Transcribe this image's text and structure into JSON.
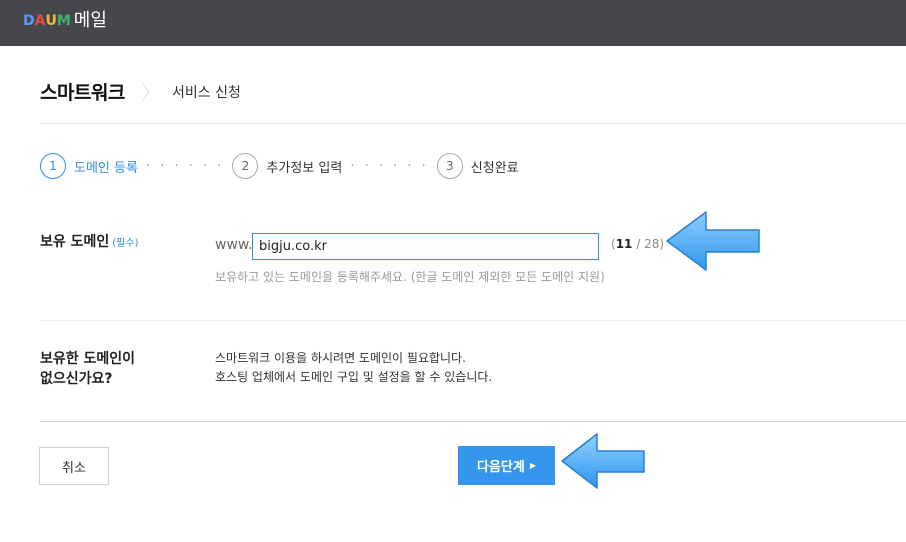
{
  "topbar": {
    "logo_letters": [
      "D",
      "A",
      "U",
      "M"
    ],
    "logo_colors": [
      "#5b9cf5",
      "#ec4a3b",
      "#f5b83d",
      "#3bb56a"
    ],
    "app_title": "메일",
    "background": "#45474d"
  },
  "header": {
    "brand": "스마트워크",
    "subtitle": "서비스 신청"
  },
  "steps": [
    {
      "number": "1",
      "label": "도메인 등록",
      "active": true
    },
    {
      "number": "2",
      "label": "추가정보 입력",
      "active": false
    },
    {
      "number": "3",
      "label": "신청완료",
      "active": false
    }
  ],
  "step_separator": "· · · · · ·",
  "domain_row": {
    "label": "보유 도메인",
    "required": "(필수)",
    "prefix": "www.",
    "value": "bigju.co.kr",
    "counter_open": "(",
    "counter_current": "11",
    "counter_rest": " / 28)",
    "help": "보유하고 있는 도메인을 등록해주세요. (한글 도메인 제외한 모든 도메인 지원)"
  },
  "no_domain_row": {
    "label_line1": "보유한 도메인이",
    "label_line2": "없으신가요?",
    "desc_line1": "스마트워크 이용을 하시려면 도메인이 필요합니다.",
    "desc_line2": "호스팅 업체에서 도메인 구입 및 설정을 할 수 있습니다."
  },
  "buttons": {
    "cancel": "취소",
    "next": "다음단계",
    "next_caret": "▶"
  },
  "colors": {
    "accent": "#2f8de4",
    "button_primary": "#3596ee",
    "annotation_arrow": "#4aaef5"
  },
  "annotations": [
    "left-arrow-icon",
    "left-arrow-icon"
  ]
}
